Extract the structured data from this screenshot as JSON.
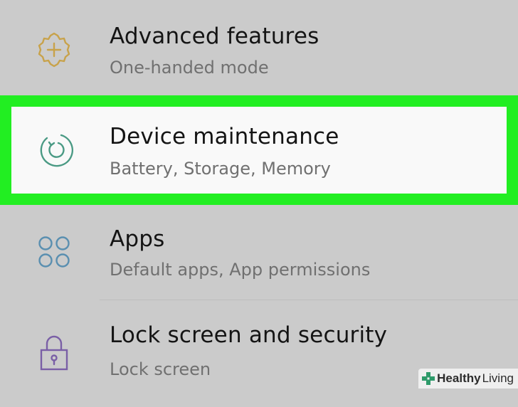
{
  "settings": {
    "items": [
      {
        "title": "Advanced features",
        "subtitle": "One-handed mode",
        "icon": "gear-plus-icon",
        "icon_color": "#c8a24a"
      },
      {
        "title": "Device maintenance",
        "subtitle": "Battery, Storage, Memory",
        "icon": "refresh-cycle-icon",
        "icon_color": "#4a9a84",
        "highlighted": true
      },
      {
        "title": "Apps",
        "subtitle": "Default apps, App permissions",
        "icon": "apps-circles-icon",
        "icon_color": "#5a8fb0"
      },
      {
        "title": "Lock screen and security",
        "subtitle": "Lock screen",
        "icon": "padlock-icon",
        "icon_color": "#7a5fa6"
      }
    ]
  },
  "colors": {
    "highlight": "#22ee22",
    "background": "#cbcbcb",
    "title_text": "#141414",
    "subtitle_text": "#707070"
  },
  "watermark": {
    "icon": "cross-plus-logo-icon",
    "text_bold": "Healthy",
    "text_regular": "Living",
    "accent": "#2e9a6a"
  }
}
